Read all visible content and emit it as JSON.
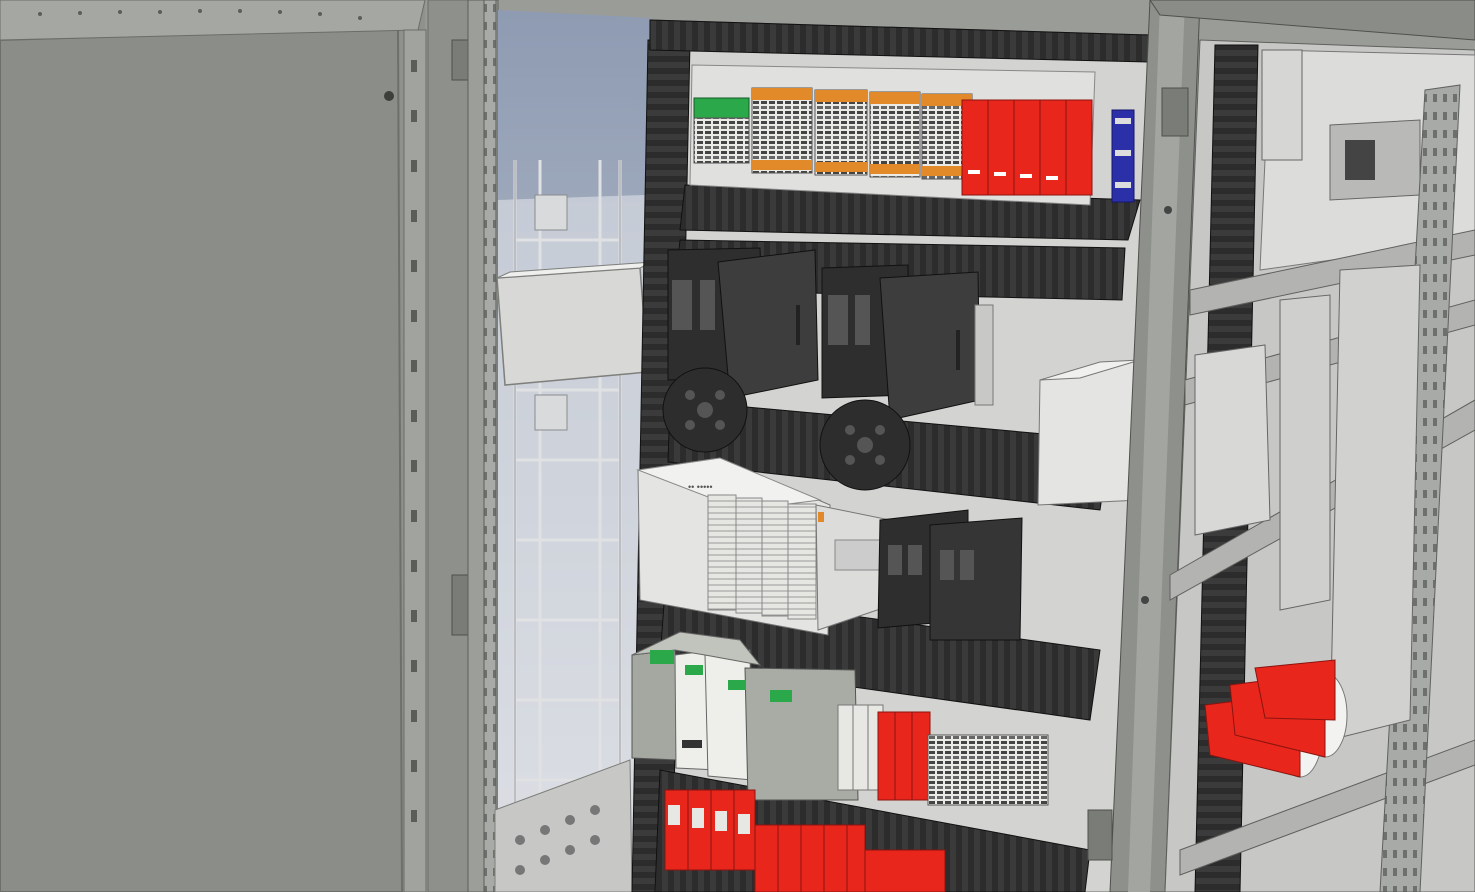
{
  "scene": {
    "subject": "electrical-control-cabinet-3d-render",
    "colors": {
      "door": "#8f918d",
      "door_edge": "#6e706c",
      "frame": "#8a8c8a",
      "backplate": "#d4d4d2",
      "duct": "#2e2e2e",
      "sky_top": "#8b9ab3",
      "sky_bottom": "#c9ced8",
      "terminal_red": "#e8261c",
      "terminal_orange": "#e28a2a",
      "terminal_green": "#2aa84a",
      "terminal_blue": "#2b2fa8",
      "drive_dark": "#3a3a3a",
      "plc_light": "#e4e4e2",
      "psu_grey": "#a4a8a0",
      "psu_white": "#eeeeea"
    },
    "labels": {
      "plc_brand": "•• •••••"
    }
  }
}
